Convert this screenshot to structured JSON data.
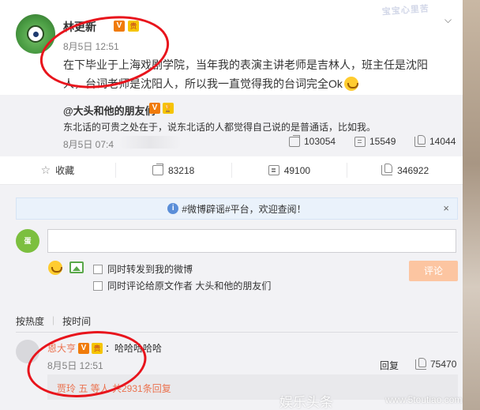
{
  "post": {
    "author": "林更新",
    "time": "8月5日 12:51",
    "text": "在下毕业于上海戏剧学院，当年我的表演主讲老师是吉林人，班主任是沈阳人，台词老师是沈阳人，所以我一直觉得我的台词完全Ok",
    "stamp": "宝宝心里苦",
    "badge_v": "V",
    "badge_gift": "贵"
  },
  "repost": {
    "author": "@大头和他的朋友们",
    "text": "东北话的可贵之处在于，说东北话的人都觉得自己说的是普通话，比如我。",
    "time": "8月5日 07:4",
    "share_count": "103054",
    "comment_count": "15549",
    "like_count": "14044"
  },
  "actions": {
    "favorite": "收藏",
    "share": "83218",
    "comment": "49100",
    "like": "346922"
  },
  "comment_panel": {
    "notice": "#微博辟谣#平台，欢迎查阅！",
    "close": "×",
    "my_avatar": "蛋",
    "input_value": "",
    "check1": "同时转发到我的微博",
    "check2": "同时评论给原文作者 大头和他的朋友们",
    "submit": "评论",
    "sort_hot": "按热度",
    "sort_sep": "|",
    "sort_time": "按时间"
  },
  "top_comment": {
    "name": "恩大亨",
    "text": "：哈哈哈哈哈",
    "time": "8月5日 12:51",
    "reply": "回复",
    "likes": "75470",
    "sub_replies": "贾玲 五 等人 共2931条回复"
  },
  "watermark": {
    "text": "娱乐头条",
    "url": "www.5toutiao.com"
  }
}
